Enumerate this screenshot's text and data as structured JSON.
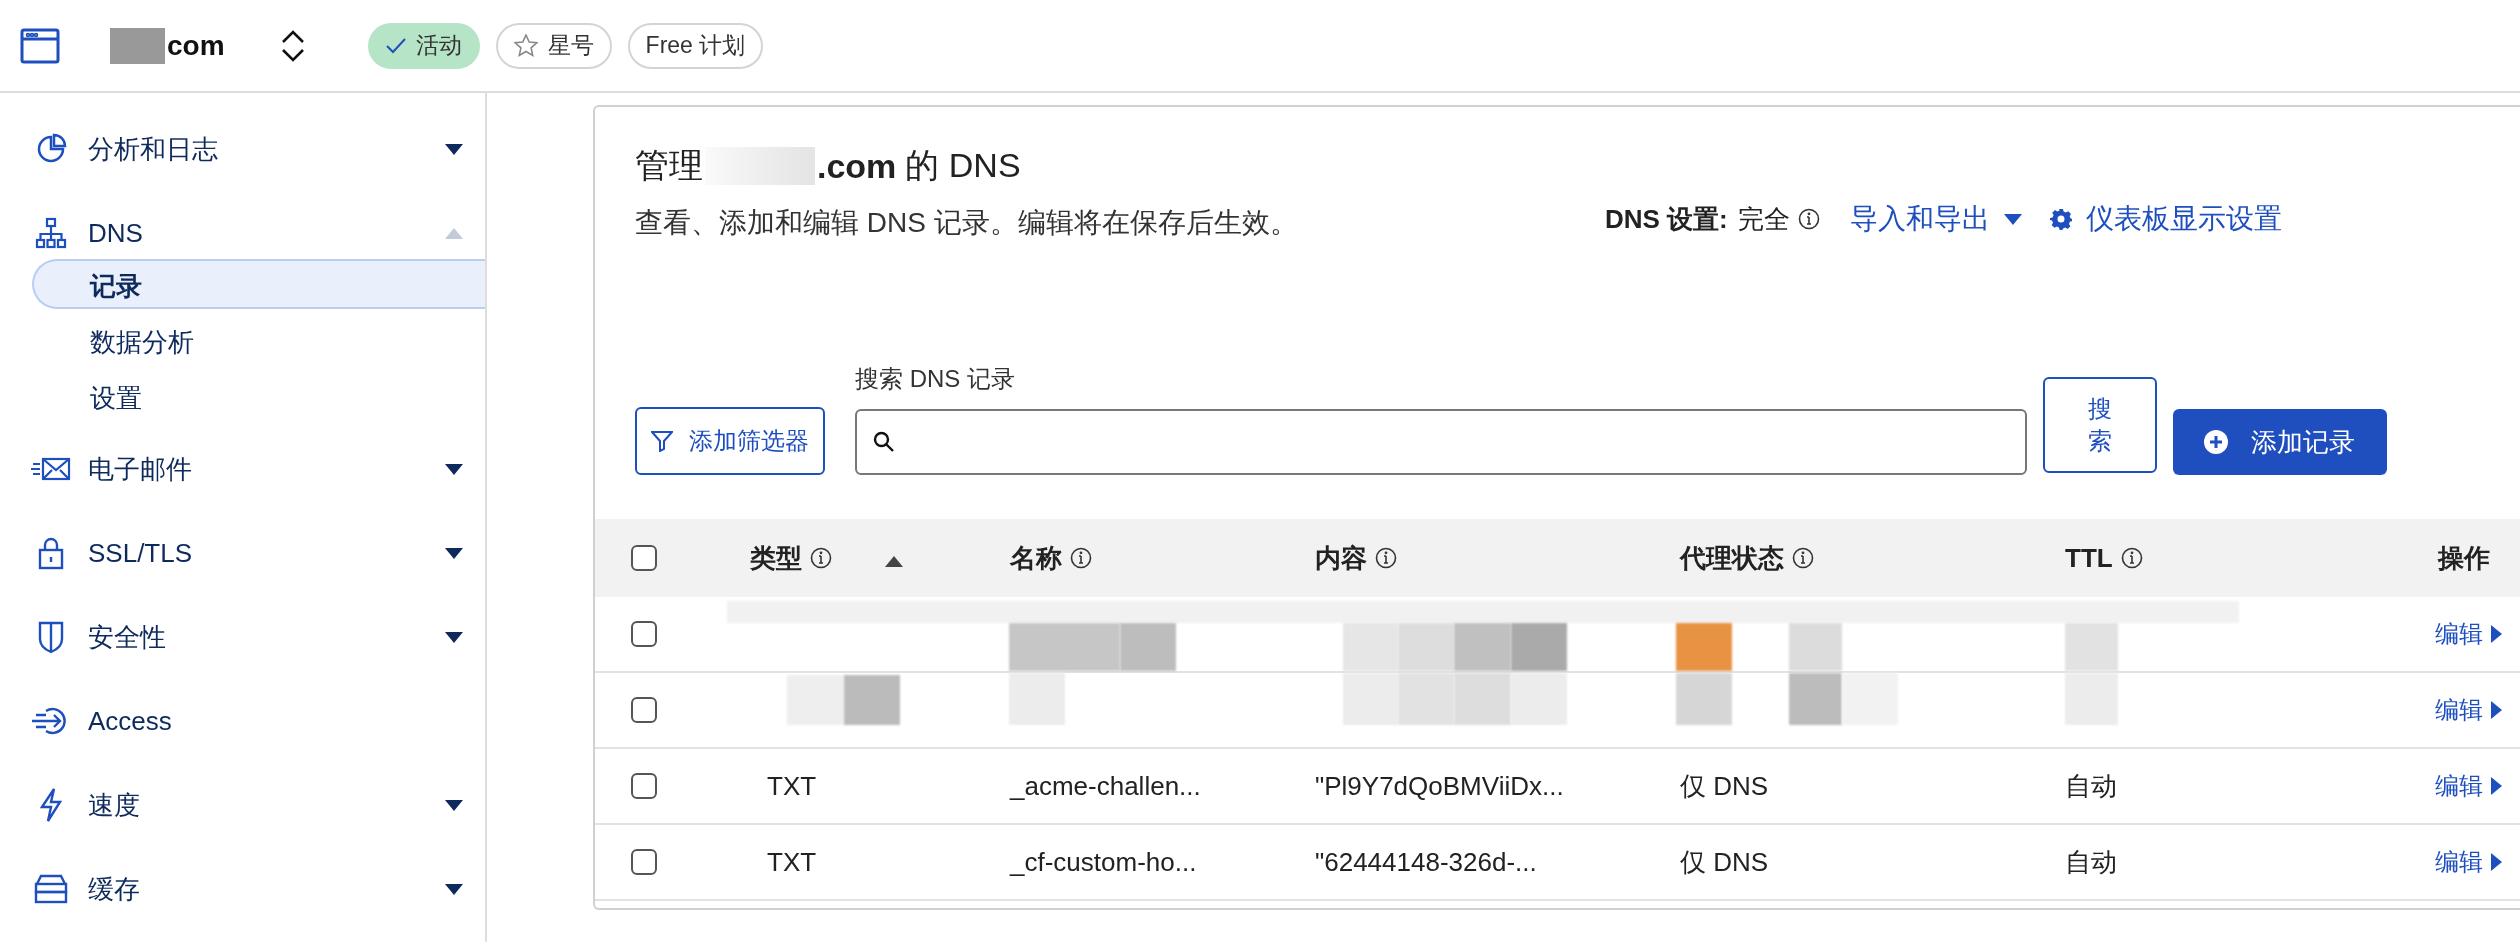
{
  "top_bar": {
    "domain": "com",
    "badges": [
      {
        "label": "活动",
        "kind": "status"
      },
      {
        "label": "星号",
        "kind": "star"
      },
      {
        "label": "Free 计划",
        "kind": "plan"
      }
    ]
  },
  "sidebar": {
    "items": [
      {
        "label": "分析和日志",
        "expanded": false
      },
      {
        "label": "DNS",
        "expanded": true,
        "children": [
          {
            "label": "记录",
            "selected": true
          },
          {
            "label": "数据分析",
            "selected": false
          },
          {
            "label": "设置",
            "selected": false
          }
        ]
      },
      {
        "label": "电子邮件",
        "expanded": false
      },
      {
        "label": "SSL/TLS",
        "expanded": false
      },
      {
        "label": "安全性",
        "expanded": false
      },
      {
        "label": "Access"
      },
      {
        "label": "速度",
        "expanded": false
      },
      {
        "label": "缓存",
        "expanded": false
      }
    ]
  },
  "header": {
    "title_prefix": "管理",
    "title_domain": ".com",
    "title_suffix": "的 DNS",
    "description": "查看、添加和编辑 DNS 记录。编辑将在保存后生效。",
    "setting_label": "DNS 设置:",
    "setting_value": "完全",
    "import_export": "导入和导出",
    "dashboard_settings": "仪表板显示设置"
  },
  "toolbar": {
    "filter_button": "添加筛选器",
    "search_label": "搜索 DNS 记录",
    "search_button": "搜索",
    "add_button": "添加记录"
  },
  "table": {
    "header_checked": false,
    "columns": [
      {
        "label": "类型",
        "info": true,
        "sorted": true
      },
      {
        "label": "名称",
        "info": true,
        "sorted": false
      },
      {
        "label": "内容",
        "info": true,
        "sorted": false
      },
      {
        "label": "代理状态",
        "info": true,
        "sorted": false
      },
      {
        "label": "TTL",
        "info": true,
        "sorted": false
      },
      {
        "label": "操作",
        "info": false,
        "sorted": false
      }
    ],
    "rows": [
      {
        "kind": "redacted",
        "checked": false,
        "action": "编辑"
      },
      {
        "kind": "redacted",
        "checked": false,
        "action": "编辑"
      },
      {
        "kind": "record",
        "checked": false,
        "type": "TXT",
        "name": "_acme-challen...",
        "content": "\"Pl9Y7dQoBMViiDx...",
        "proxy": "仅 DNS",
        "ttl": "自动",
        "action": "编辑"
      },
      {
        "kind": "record",
        "checked": false,
        "type": "TXT",
        "name": "_cf-custom-ho...",
        "content": "\"62444148-326d-...",
        "proxy": "仅 DNS",
        "ttl": "自动",
        "action": "编辑"
      }
    ]
  }
}
